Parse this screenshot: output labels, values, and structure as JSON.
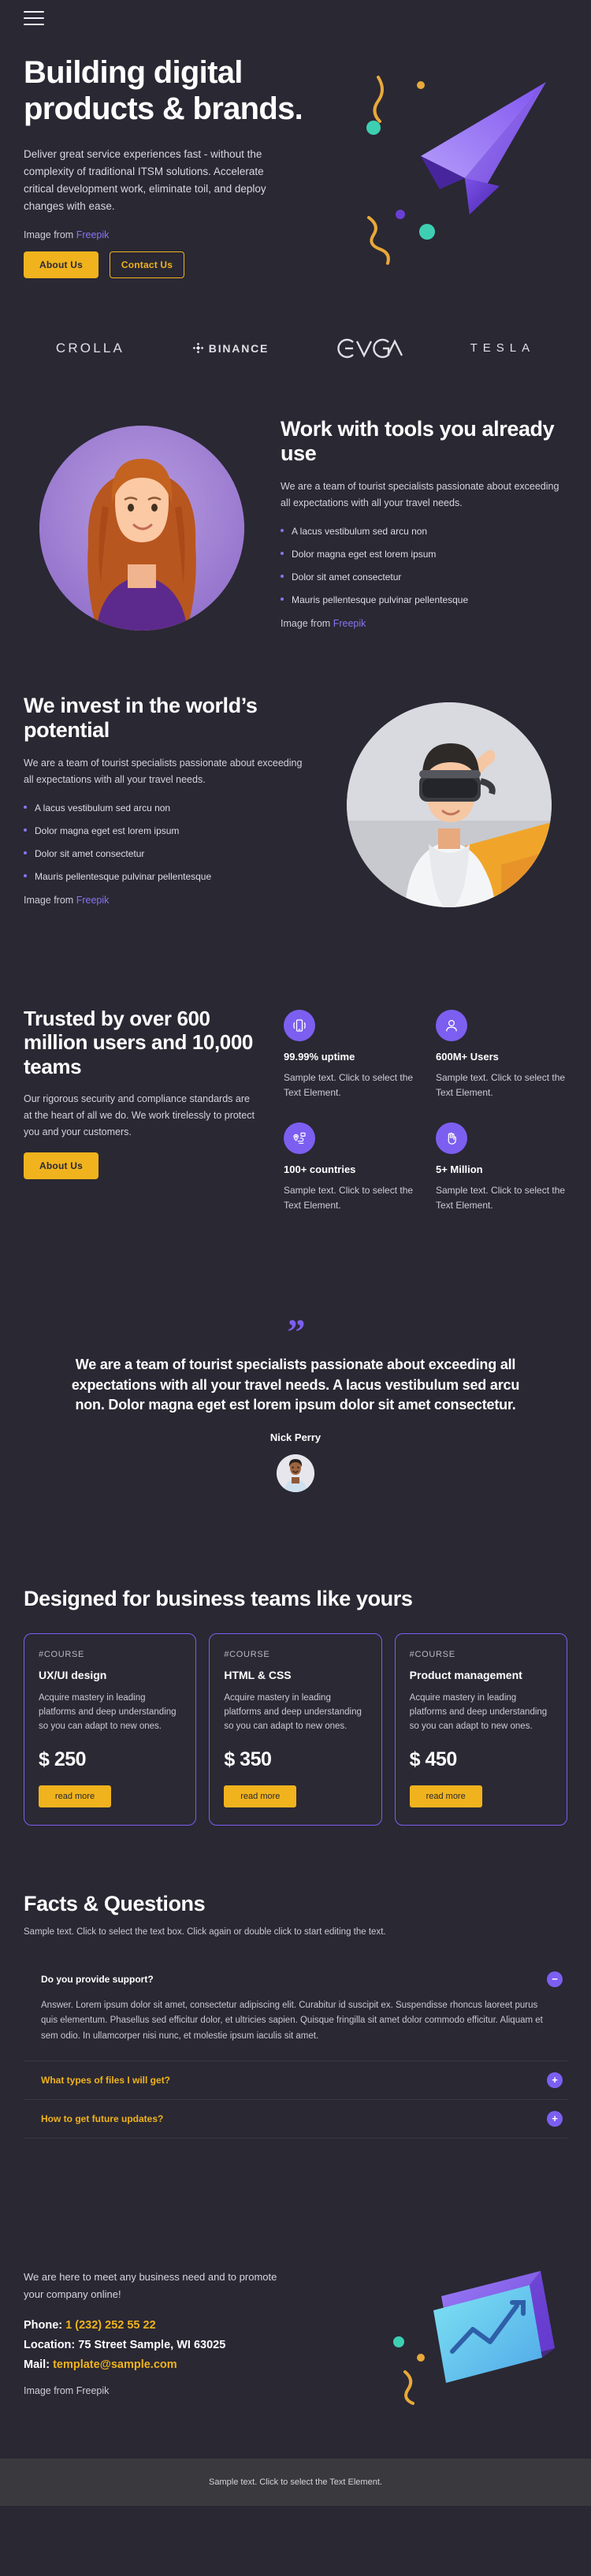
{
  "colors": {
    "background": "#2a2833",
    "accent_yellow": "#f0b31d",
    "accent_purple": "#7c5ff0",
    "link_purple": "#8a74f0",
    "footer_bar": "#3a3a3e"
  },
  "nav": {
    "menu_label": "menu"
  },
  "hero": {
    "title": "Building digital products & brands.",
    "paragraph": "Deliver great service experiences fast - without the complexity of traditional ITSM solutions. Accelerate critical development work, eliminate toil, and deploy changes with ease.",
    "credit_prefix": "Image from",
    "credit_link": "Freepik",
    "primary_button": "About Us",
    "secondary_button": "Contact Us"
  },
  "logos": [
    {
      "name": "CROLLA"
    },
    {
      "name": "BINANCE"
    },
    {
      "name": "EVGA"
    },
    {
      "name": "TESLA"
    }
  ],
  "tools_section": {
    "title": "Work with tools you already use",
    "paragraph": "We are a team of tourist specialists passionate about exceeding all expectations with all your travel needs.",
    "features": [
      "A lacus vestibulum sed arcu non",
      "Dolor magna eget est lorem ipsum",
      "Dolor sit amet consectetur",
      "Mauris pellentesque pulvinar pellentesque"
    ],
    "credit_prefix": "Image from",
    "credit_link": "Freepik"
  },
  "invest_section": {
    "title": "We invest in the world’s potential",
    "paragraph": "We are a team of tourist specialists passionate about exceeding all expectations with all your travel needs.",
    "features": [
      "A lacus vestibulum sed arcu non",
      "Dolor magna eget est lorem ipsum",
      "Dolor sit amet consectetur",
      "Mauris pellentesque pulvinar pellentesque"
    ],
    "credit_prefix": "Image from",
    "credit_link": "Freepik"
  },
  "stats_section": {
    "title": "Trusted by over 600 million users and 10,000 teams",
    "paragraph": "Our rigorous security and compliance standards are at the heart of all we do. We work tirelessly to protect you and your customers.",
    "button": "About Us",
    "items": [
      {
        "icon": "mobile-signal-icon",
        "value": "99.99% uptime",
        "desc": "Sample text. Click to select the Text Element."
      },
      {
        "icon": "user-icon",
        "value": "600M+ Users",
        "desc": "Sample text. Click to select the Text Element."
      },
      {
        "icon": "map-route-icon",
        "value": "100+ countries",
        "desc": "Sample text. Click to select the Text Element."
      },
      {
        "icon": "hand-icon",
        "value": "5+ Million",
        "desc": "Sample text. Click to select the Text Element."
      }
    ]
  },
  "testimonial": {
    "quote_glyph": "”",
    "text": "We are a team of tourist specialists passionate about exceeding all expectations with all your travel needs. A lacus vestibulum sed arcu non. Dolor magna eget est lorem ipsum dolor sit amet consectetur.",
    "author": "Nick Perry"
  },
  "pricing": {
    "title": "Designed for business teams like yours",
    "cards": [
      {
        "tag": "#COURSE",
        "name": "UX/UI design",
        "desc": "Acquire mastery in leading platforms and deep understanding so you can adapt to new ones.",
        "price": "$ 250",
        "button": "read more"
      },
      {
        "tag": "#COURSE",
        "name": "HTML & CSS",
        "desc": "Acquire mastery in leading platforms and deep understanding so you can adapt to new ones.",
        "price": "$ 350",
        "button": "read more"
      },
      {
        "tag": "#COURSE",
        "name": "Product management",
        "desc": "Acquire mastery in leading platforms and deep understanding so you can adapt to new ones.",
        "price": "$ 450",
        "button": "read more"
      }
    ]
  },
  "faq": {
    "title": "Facts & Questions",
    "subtitle": "Sample text. Click to select the text box. Click again or double click to start editing the text.",
    "items": [
      {
        "question": "Do you provide support?",
        "expanded": true,
        "toggle": "−",
        "answer": "Answer. Lorem ipsum dolor sit amet, consectetur adipiscing elit. Curabitur id suscipit ex. Suspendisse rhoncus laoreet purus quis elementum. Phasellus sed efficitur dolor, et ultricies sapien. Quisque fringilla sit amet dolor commodo efficitur. Aliquam et sem odio. In ullamcorper nisi nunc, et molestie ipsum iaculis sit amet."
      },
      {
        "question": "What types of files I will get?",
        "expanded": false,
        "toggle": "+",
        "answer": ""
      },
      {
        "question": "How to get future updates?",
        "expanded": false,
        "toggle": "+",
        "answer": ""
      }
    ]
  },
  "contact": {
    "lead": "We are here to meet any business need and to promote your company online!",
    "phone_label": "Phone:",
    "phone_value": "1 (232) 252 55 22",
    "location_label": "Location:",
    "location_value": "75 Street Sample, WI 63025",
    "mail_label": "Mail:",
    "mail_value": "template@sample.com",
    "credit_prefix": "Image from",
    "credit_link": "Freepik"
  },
  "footer": {
    "text": "Sample text. Click to select the Text Element."
  }
}
